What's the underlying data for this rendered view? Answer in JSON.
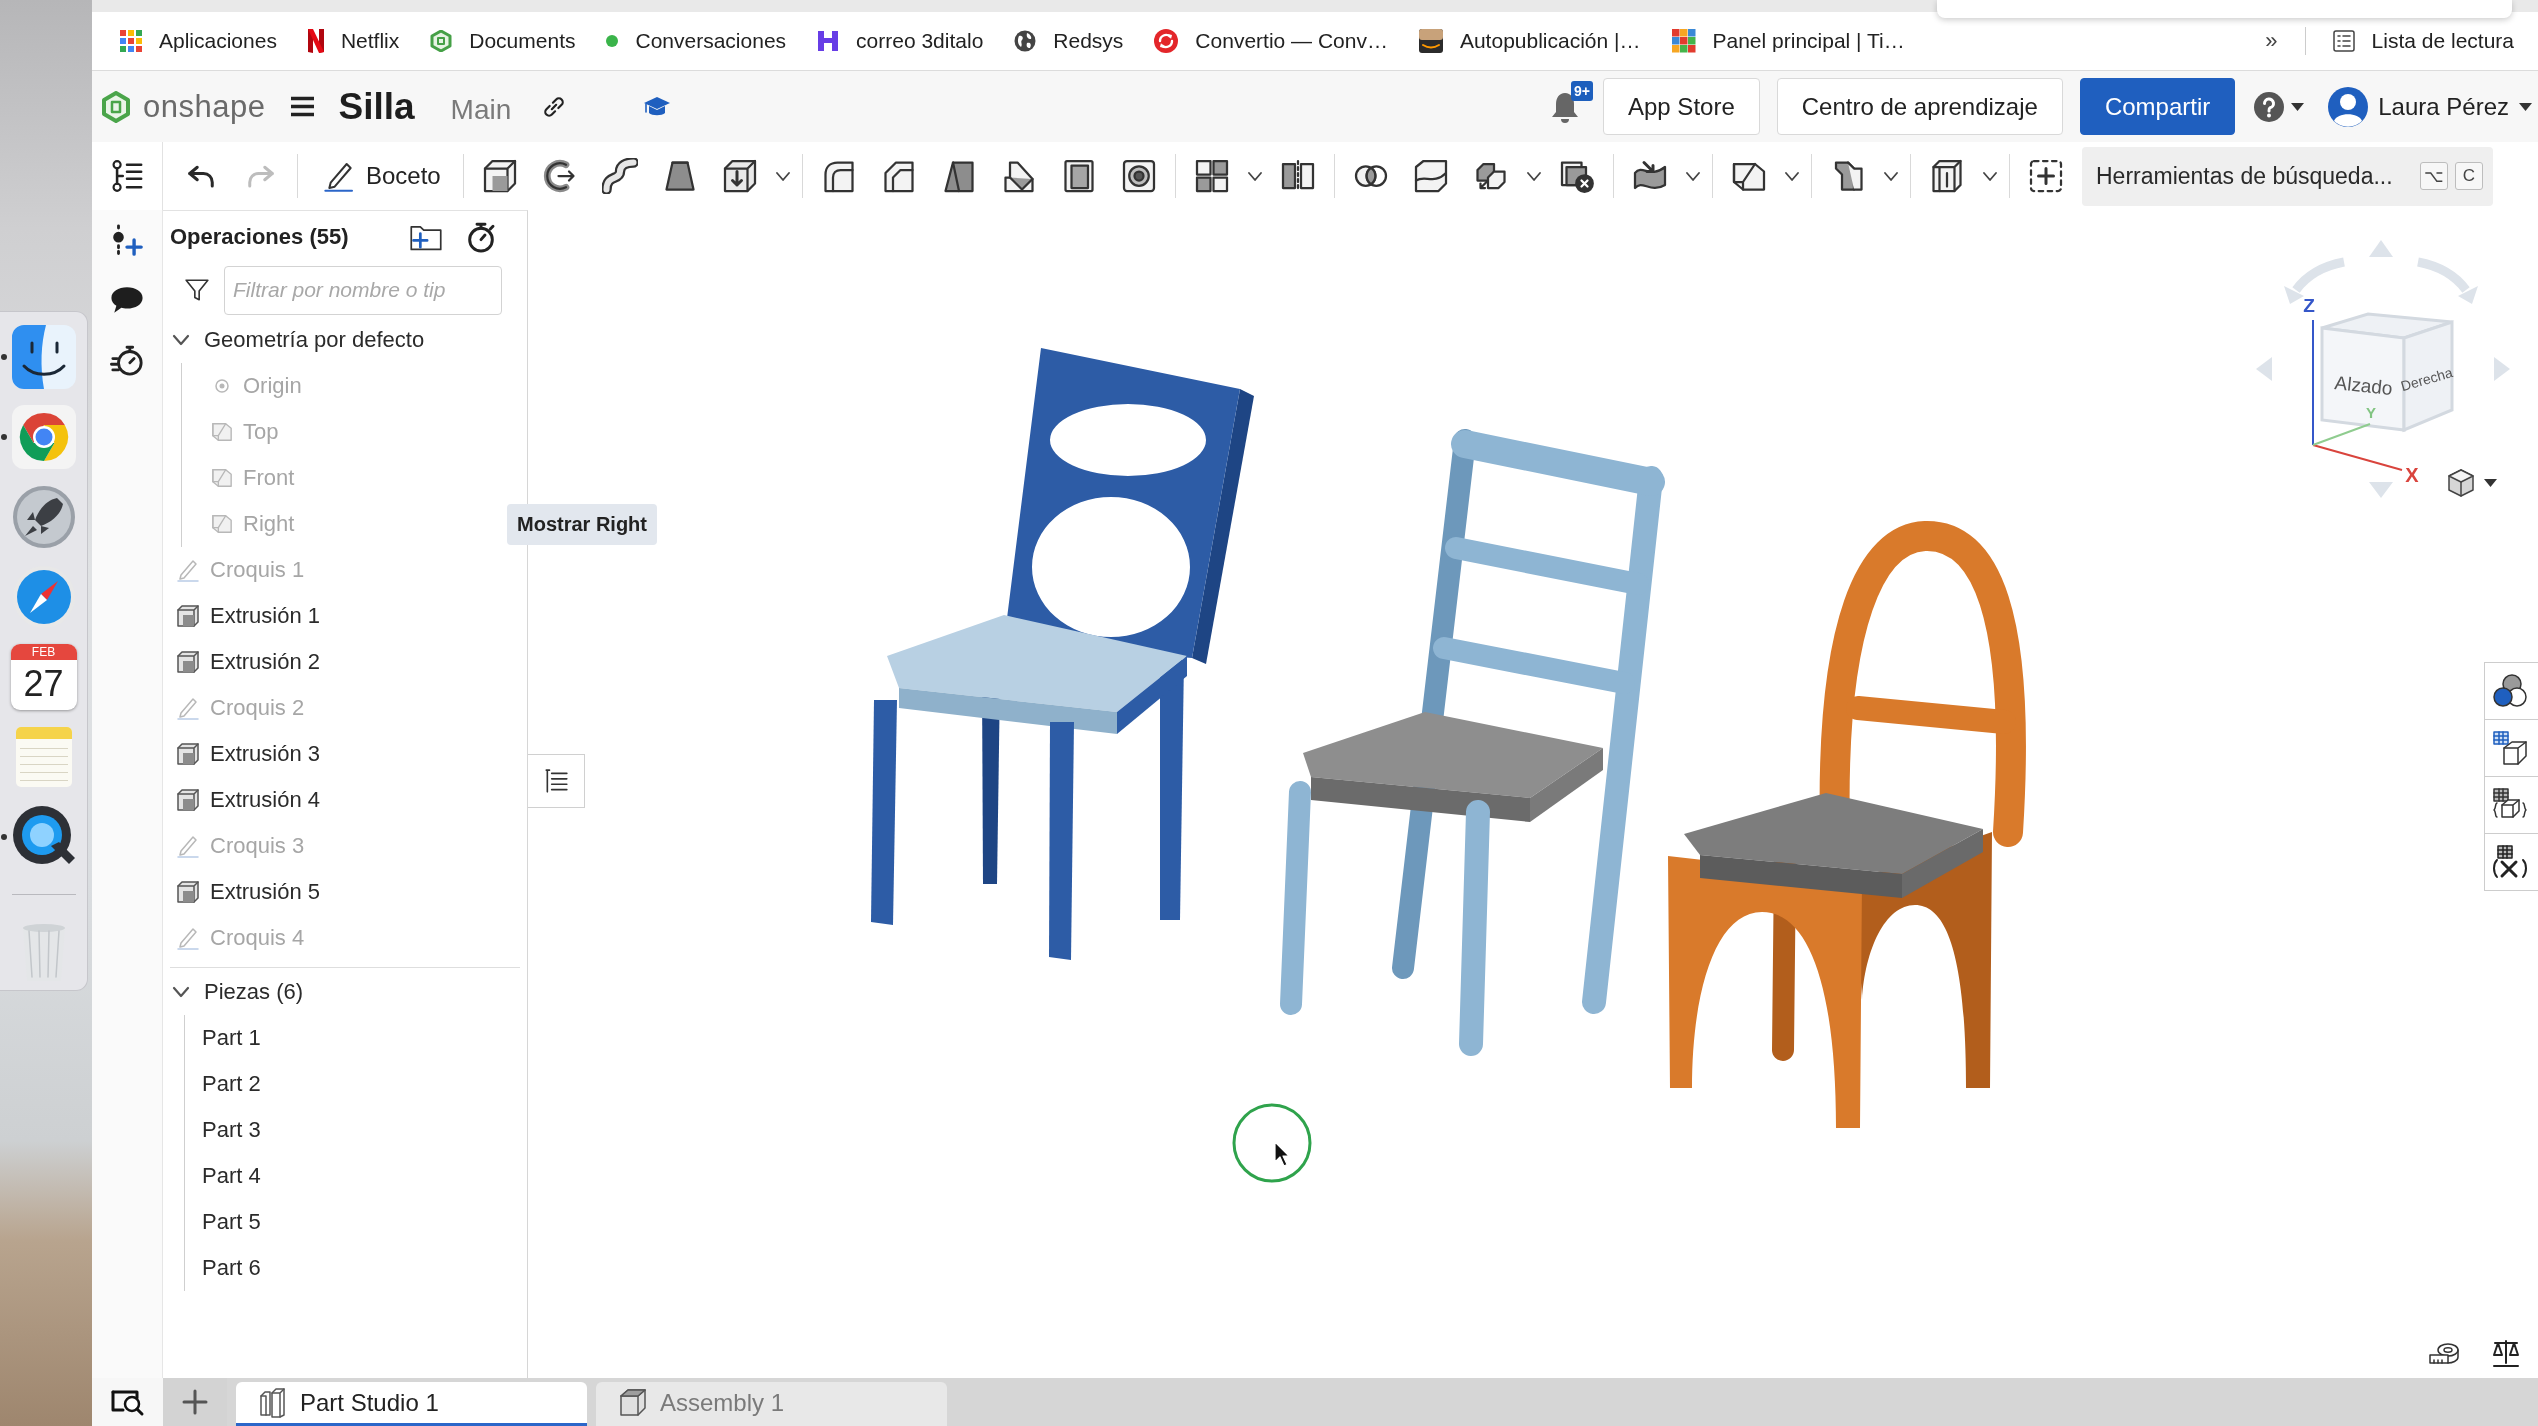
{
  "browser": {
    "bookmarks": [
      {
        "kind": "grid",
        "label": "Aplicaciones"
      },
      {
        "kind": "ribbon",
        "label": "Netflix"
      },
      {
        "kind": "hexagon",
        "label": "Documents"
      },
      {
        "kind": "dot",
        "label": "Conversaciones"
      },
      {
        "kind": "h-block",
        "label": "correo 3ditalo"
      },
      {
        "kind": "globe",
        "label": "Redsys"
      },
      {
        "kind": "cycle",
        "label": "Convertio — Conv…"
      },
      {
        "kind": "box",
        "label": "Autopublicación |…"
      },
      {
        "kind": "tiles",
        "label": "Panel principal | Ti…"
      }
    ],
    "overflow": "»",
    "reading_list": "Lista de lectura"
  },
  "dock": {
    "apps": [
      {
        "kind": "finder",
        "running": true
      },
      {
        "kind": "chrome",
        "running": true
      },
      {
        "kind": "launchpad",
        "running": false
      },
      {
        "kind": "safari",
        "running": false
      },
      {
        "kind": "calendar",
        "running": false,
        "month": "FEB",
        "day": "27"
      },
      {
        "kind": "notes",
        "running": false
      },
      {
        "kind": "quicktime",
        "running": true
      },
      {
        "kind": "trash",
        "running": false
      }
    ]
  },
  "header": {
    "logo": "onshape",
    "document": "Silla",
    "workspace": "Main",
    "notifications": "9+",
    "buttons": [
      {
        "label": "App Store",
        "primary": false
      },
      {
        "label": "Centro de aprendizaje",
        "primary": false
      },
      {
        "label": "Compartir",
        "primary": true
      }
    ],
    "user": "Laura Pérez"
  },
  "toolbar": {
    "undo": {
      "disabled": false
    },
    "redo": {
      "disabled": true
    },
    "sketch": "Boceto",
    "search": {
      "placeholder": "Herramientas de búsqueda...",
      "keys": [
        "⌥",
        "C"
      ]
    }
  },
  "feature_list": {
    "title": "Operaciones (55)",
    "filter": {
      "placeholder": "Filtrar por nombre o tip"
    },
    "items": [
      {
        "kind": "folder",
        "label": "Geometría por defecto",
        "expanded": true,
        "children": [
          {
            "kind": "origin",
            "label": "Origin",
            "hidden": true
          },
          {
            "kind": "plane",
            "label": "Top",
            "hidden": true
          },
          {
            "kind": "plane",
            "label": "Front",
            "hidden": true
          },
          {
            "kind": "plane",
            "label": "Right",
            "hidden": true
          }
        ]
      },
      {
        "kind": "sketch",
        "label": "Croquis 1",
        "hidden": true
      },
      {
        "kind": "extrude",
        "label": "Extrusión 1",
        "hidden": false
      },
      {
        "kind": "extrude",
        "label": "Extrusión 2",
        "hidden": false
      },
      {
        "kind": "sketch",
        "label": "Croquis 2",
        "hidden": true
      },
      {
        "kind": "extrude",
        "label": "Extrusión 3",
        "hidden": false
      },
      {
        "kind": "extrude",
        "label": "Extrusión 4",
        "hidden": false
      },
      {
        "kind": "sketch",
        "label": "Croquis 3",
        "hidden": true
      },
      {
        "kind": "extrude",
        "label": "Extrusión 5",
        "hidden": false
      },
      {
        "kind": "sketch",
        "label": "Croquis 4",
        "hidden": true
      }
    ]
  },
  "parts": {
    "label": "Piezas (6)",
    "expanded": true,
    "children": [
      {
        "label": "Part 1"
      },
      {
        "label": "Part 2"
      },
      {
        "label": "Part 3"
      },
      {
        "label": "Part 4"
      },
      {
        "label": "Part 5"
      },
      {
        "label": "Part 6"
      }
    ]
  },
  "tooltip": "Mostrar Right",
  "view_cube": {
    "faces": [
      "Alzado",
      "Derecha"
    ],
    "axes": [
      "Z",
      "Y",
      "X"
    ]
  },
  "tabs": [
    {
      "kind": "part-studio",
      "label": "Part Studio 1",
      "selected": true
    },
    {
      "kind": "assembly",
      "label": "Assembly 1",
      "selected": false
    }
  ]
}
